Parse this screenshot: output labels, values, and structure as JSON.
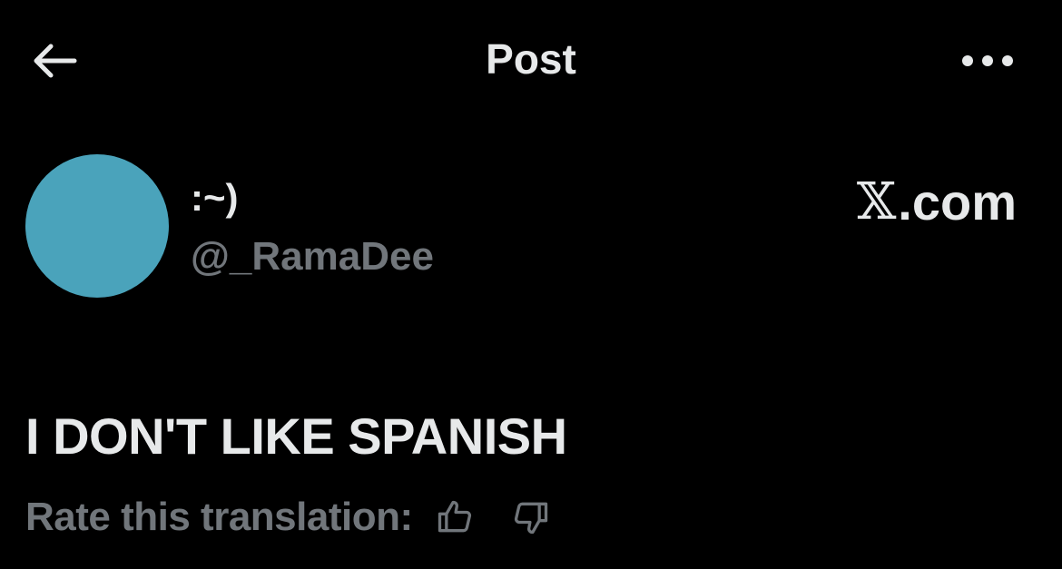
{
  "header": {
    "title": "Post",
    "back_icon": "arrow-left-icon",
    "more_icon": "more-horizontal-icon"
  },
  "post": {
    "author": {
      "display_name": ":~)",
      "handle": "@_RamaDee",
      "avatar_color": "#4aa3bb"
    },
    "text": "I DON'T LIKE SPANISH"
  },
  "watermark": {
    "logo_letter": "𝕏",
    "suffix": ".com"
  },
  "translation_rating": {
    "label": "Rate this translation:",
    "thumbs_up_icon": "thumbs-up-icon",
    "thumbs_down_icon": "thumbs-down-icon"
  },
  "colors": {
    "background": "#000000",
    "primary_text": "#e7e9ea",
    "secondary_text": "#71767b"
  }
}
